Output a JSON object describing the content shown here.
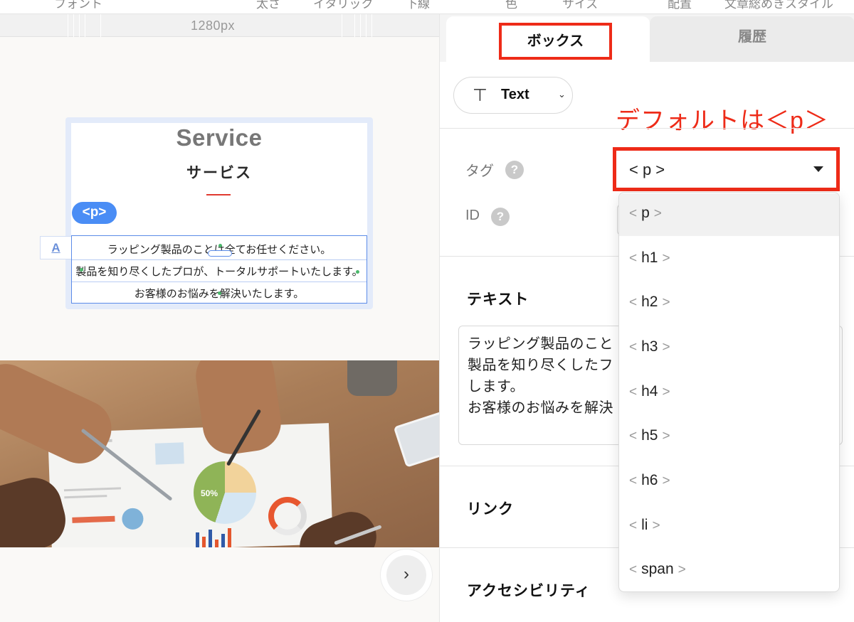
{
  "top_strip": [
    "フォント",
    "太さ",
    "イタリック",
    "下線",
    "色",
    "サイズ",
    "配置",
    "文章総めきスタイル"
  ],
  "canvas": {
    "ruler_label": "1280px",
    "service_title": "Service",
    "service_subtitle": "サービス",
    "tag_badge": "<p>",
    "text_icon": "A",
    "body_lines": [
      "ラッピング製品のことは全てお任せください。",
      "製品を知り尽くしたプロが、トータルサポートいたします。",
      "お客様のお悩みを解決いたします。"
    ],
    "pie_label": "50%",
    "next_icon": "›"
  },
  "panel": {
    "tabs": {
      "box": "ボックス",
      "history": "履歴"
    },
    "type_selector": {
      "icon": "⊤",
      "label": "Text",
      "chevron": "⌄"
    },
    "annotation": "デフォルトは＜p＞",
    "tag": {
      "label": "タグ",
      "help": "?",
      "value": "< p >"
    },
    "id": {
      "label": "ID",
      "help": "?"
    },
    "text_section": {
      "title": "テキスト",
      "lines": [
        "ラッピング製品のこと",
        "製品を知り尽くしたフ",
        "します。",
        "お客様のお悩みを解決"
      ]
    },
    "link_section": {
      "title": "リンク"
    },
    "accessibility_section": {
      "title": "アクセシビリティ"
    },
    "tag_options": [
      "p",
      "h1",
      "h2",
      "h3",
      "h4",
      "h5",
      "h6",
      "li",
      "span"
    ],
    "tag_selected": "p"
  },
  "colors": {
    "accent_red": "#ee2b18",
    "badge_blue": "#4a8df5",
    "selection_blue": "#5b8be8"
  }
}
